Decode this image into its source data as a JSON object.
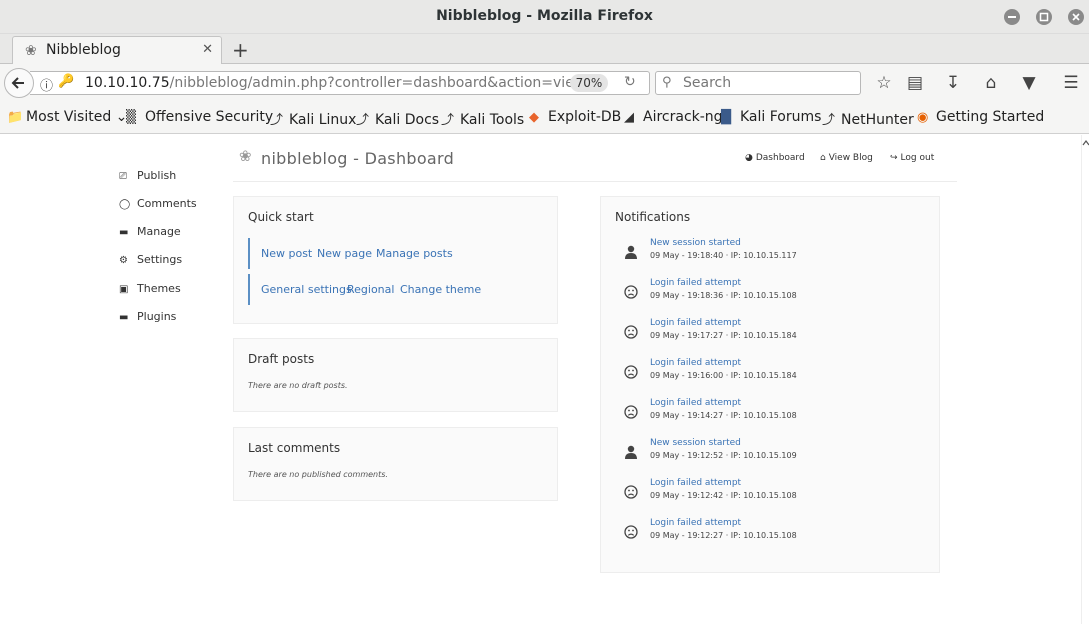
{
  "window": {
    "title": "Nibbleblog - Mozilla Firefox"
  },
  "tab": {
    "label": "Nibbleblog"
  },
  "navbar": {
    "url_host": "10.10.10.75",
    "url_path": "/nibbleblog/admin.php?controller=dashboard&action=view",
    "zoom": "70%",
    "search_placeholder": "Search"
  },
  "bookmarks": [
    {
      "label": "Most Visited",
      "icon": "chevron-down-icon"
    },
    {
      "label": "Offensive Security",
      "icon": "offsec-icon"
    },
    {
      "label": "Kali Linux",
      "icon": "kali-icon"
    },
    {
      "label": "Kali Docs",
      "icon": "kali-icon"
    },
    {
      "label": "Kali Tools",
      "icon": "kali-icon"
    },
    {
      "label": "Exploit-DB",
      "icon": "exploitdb-icon"
    },
    {
      "label": "Aircrack-ng",
      "icon": "aircrack-icon"
    },
    {
      "label": "Kali Forums",
      "icon": "kali-forums-icon"
    },
    {
      "label": "NetHunter",
      "icon": "kali-icon"
    },
    {
      "label": "Getting Started",
      "icon": "firefox-icon"
    }
  ],
  "sidebar": {
    "items": [
      {
        "label": "Publish",
        "icon": "publish-icon"
      },
      {
        "label": "Comments",
        "icon": "comment-icon"
      },
      {
        "label": "Manage",
        "icon": "folder-icon"
      },
      {
        "label": "Settings",
        "icon": "gear-icon"
      },
      {
        "label": "Themes",
        "icon": "image-icon"
      },
      {
        "label": "Plugins",
        "icon": "folder-icon"
      }
    ]
  },
  "header": {
    "title": "nibbleblog - Dashboard",
    "links": [
      {
        "label": "Dashboard",
        "icon": "dashboard-icon"
      },
      {
        "label": "View Blog",
        "icon": "home-icon"
      },
      {
        "label": "Log out",
        "icon": "logout-icon"
      }
    ]
  },
  "quick_start": {
    "title": "Quick start",
    "row1": [
      "New post",
      "New page",
      "Manage posts"
    ],
    "row2": [
      "General settings",
      "Regional",
      "Change theme"
    ]
  },
  "draft_posts": {
    "title": "Draft posts",
    "empty": "There are no draft posts."
  },
  "last_comments": {
    "title": "Last comments",
    "empty": "There are no published comments."
  },
  "notifications": {
    "title": "Notifications",
    "items": [
      {
        "title": "New session started",
        "detail": "09 May - 19:18:40 · IP: 10.10.15.117",
        "icon": "user-icon"
      },
      {
        "title": "Login failed attempt",
        "detail": "09 May - 19:18:36 · IP: 10.10.15.108",
        "icon": "sad-face-icon"
      },
      {
        "title": "Login failed attempt",
        "detail": "09 May - 19:17:27 · IP: 10.10.15.184",
        "icon": "sad-face-icon"
      },
      {
        "title": "Login failed attempt",
        "detail": "09 May - 19:16:00 · IP: 10.10.15.184",
        "icon": "sad-face-icon"
      },
      {
        "title": "Login failed attempt",
        "detail": "09 May - 19:14:27 · IP: 10.10.15.108",
        "icon": "sad-face-icon"
      },
      {
        "title": "New session started",
        "detail": "09 May - 19:12:52 · IP: 10.10.15.109",
        "icon": "user-icon"
      },
      {
        "title": "Login failed attempt",
        "detail": "09 May - 19:12:42 · IP: 10.10.15.108",
        "icon": "sad-face-icon"
      },
      {
        "title": "Login failed attempt",
        "detail": "09 May - 19:12:27 · IP: 10.10.15.108",
        "icon": "sad-face-icon"
      }
    ]
  }
}
